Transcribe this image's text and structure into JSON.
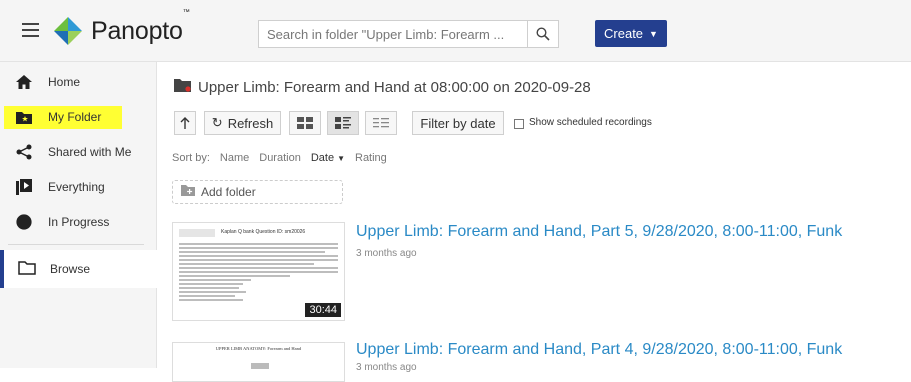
{
  "header": {
    "logo_text": "Panopto",
    "logo_tm": "™",
    "search_placeholder": "Search in folder \"Upper Limb: Forearm ...",
    "create_label": "Create",
    "colors": {
      "brand_blue": "#243f8f",
      "logo_green": "#6cbf3e",
      "logo_blue": "#1f6fb5"
    }
  },
  "sidebar": {
    "items": [
      {
        "label": "Home",
        "icon": "home-icon"
      },
      {
        "label": "My Folder",
        "icon": "folder-star-icon",
        "highlighted": true
      },
      {
        "label": "Shared with Me",
        "icon": "share-icon"
      },
      {
        "label": "Everything",
        "icon": "play-box-icon"
      },
      {
        "label": "In Progress",
        "icon": "half-circle-icon"
      }
    ],
    "browse_label": "Browse",
    "highlight_color": "#ffff33"
  },
  "main": {
    "folder_title": "Upper Limb: Forearm and Hand at 08:00:00 on 2020-09-28",
    "toolbar": {
      "refresh_label": "Refresh",
      "filter_label": "Filter by date",
      "show_scheduled_label": "Show scheduled recordings"
    },
    "sort": {
      "label": "Sort by:",
      "options": [
        "Name",
        "Duration",
        "Date",
        "Rating"
      ],
      "active": "Date"
    },
    "add_folder_label": "Add folder",
    "sessions": [
      {
        "title": "Upper Limb: Forearm and Hand, Part 5, 9/28/2020, 8:00-11:00, Funk",
        "age": "3 months ago",
        "duration": "30:44",
        "thumb_heading": "Kaplan Q bank Question ID: sm20026"
      },
      {
        "title": "Upper Limb: Forearm and Hand, Part 4, 9/28/2020, 8:00-11:00, Funk",
        "age": "3 months ago",
        "thumb_heading": "UPPER LIMB ANATOMY: Forearm and Hand"
      }
    ]
  }
}
